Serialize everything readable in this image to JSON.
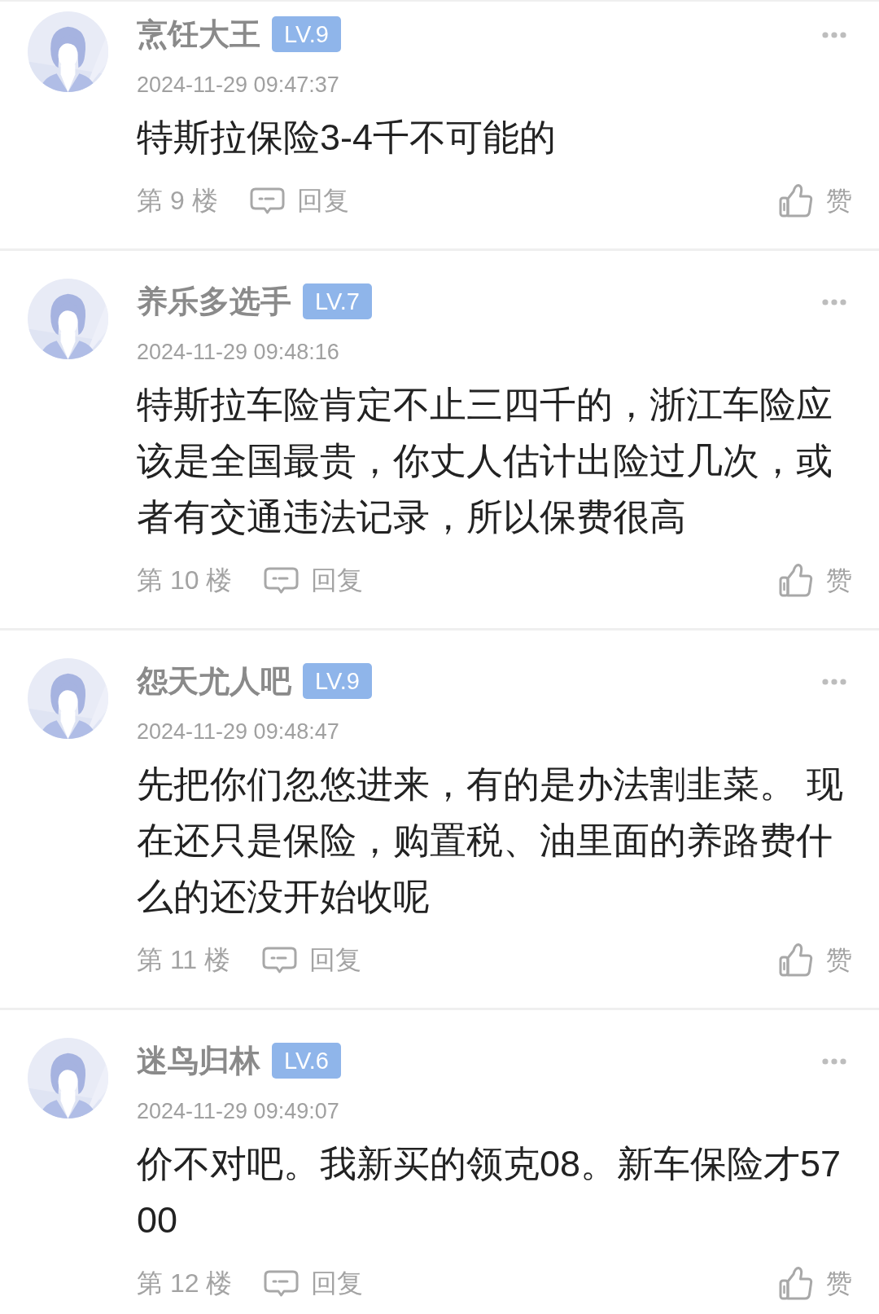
{
  "comments": [
    {
      "user": {
        "name": "烹饪大王",
        "badge": "LV.9"
      },
      "time": "2024-11-29 09:47:37",
      "text": "特斯拉保险3-4千不可能的",
      "floor": "第 9 楼",
      "reply": "回复",
      "like": "赞"
    },
    {
      "user": {
        "name": "养乐多选手",
        "badge": "LV.7"
      },
      "time": "2024-11-29 09:48:16",
      "text": "特斯拉车险肯定不止三四千的，浙江车险应该是全国最贵，你丈人估计出险过几次，或者有交通违法记录，所以保费很高",
      "floor": "第 10 楼",
      "reply": "回复",
      "like": "赞"
    },
    {
      "user": {
        "name": "怨天尤人吧",
        "badge": "LV.9"
      },
      "time": "2024-11-29 09:48:47",
      "text": "先把你们忽悠进来，有的是办法割韭菜。 现在还只是保险，购置税、油里面的养路费什么的还没开始收呢",
      "floor": "第 11 楼",
      "reply": "回复",
      "like": "赞"
    },
    {
      "user": {
        "name": "迷鸟归林",
        "badge": "LV.6"
      },
      "time": "2024-11-29 09:49:07",
      "text": "价不对吧。我新买的领克08。新车保险才5700",
      "floor": "第 12 楼",
      "reply": "回复",
      "like": "赞"
    }
  ]
}
